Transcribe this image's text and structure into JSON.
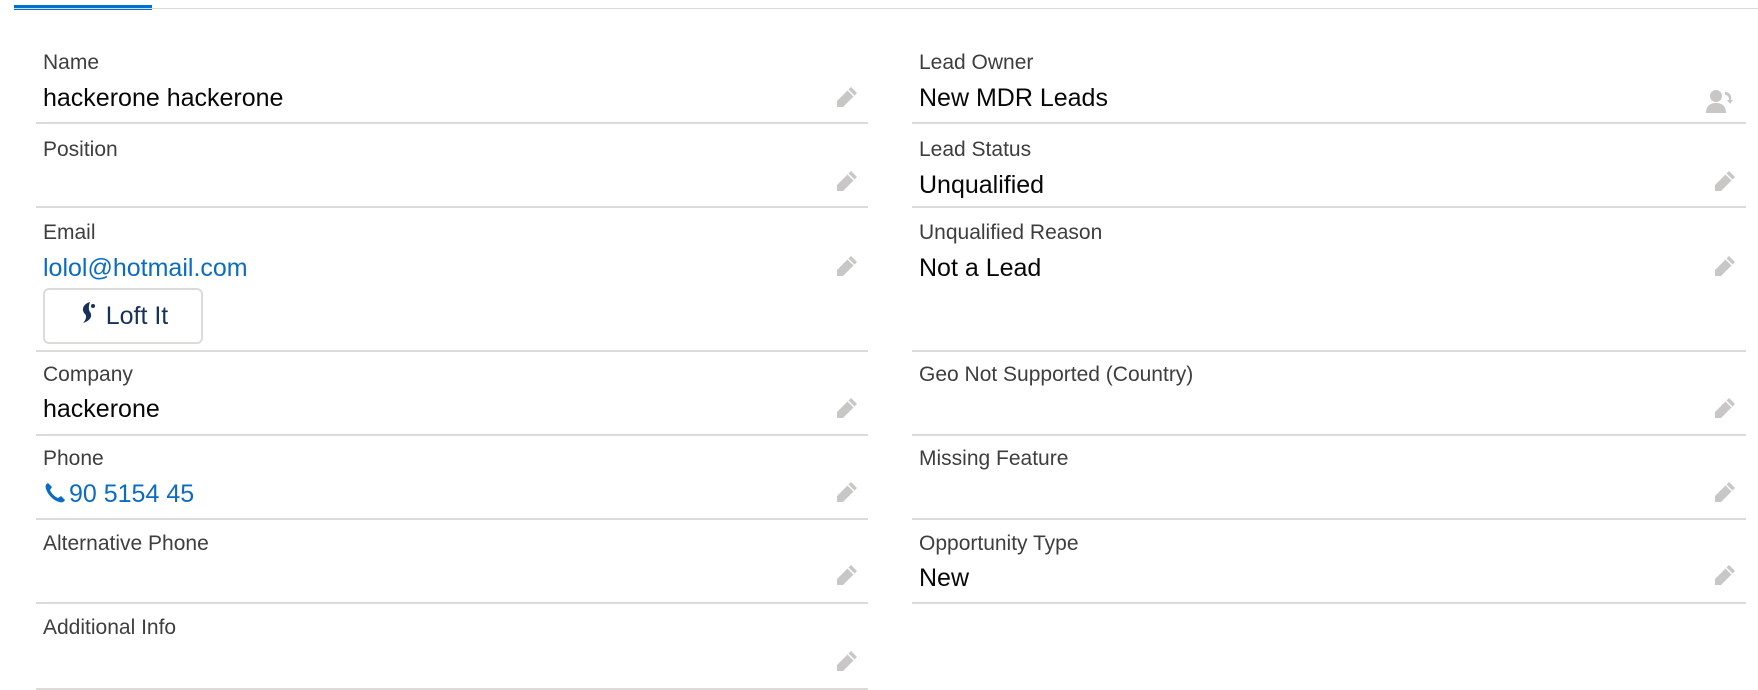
{
  "left_fields": [
    {
      "label": "Name",
      "value": "hackerone hackerone"
    },
    {
      "label": "Position",
      "value": ""
    },
    {
      "label": "Email",
      "value": "lolol@hotmail.com",
      "button_label": "Loft It"
    },
    {
      "label": "Company",
      "value": "hackerone"
    },
    {
      "label": "Phone",
      "value": "90 5154 45"
    },
    {
      "label": "Alternative Phone",
      "value": ""
    },
    {
      "label": "Additional Info",
      "value": ""
    }
  ],
  "right_fields": [
    {
      "label": "Lead Owner",
      "value": "New MDR Leads"
    },
    {
      "label": "Lead Status",
      "value": "Unqualified"
    },
    {
      "label": "Unqualified Reason",
      "value": "Not a Lead"
    },
    {
      "label": "Geo Not Supported (Country)",
      "value": ""
    },
    {
      "label": "Missing Feature",
      "value": ""
    },
    {
      "label": "Opportunity Type",
      "value": "New"
    }
  ],
  "colors": {
    "accent": "#0070d2",
    "link": "#0b6cc4",
    "divider": "#dddbda",
    "label": "#3e3e3c",
    "icon": "#c9c7c5"
  },
  "icons": {
    "edit": "pencil-icon",
    "owner": "change-owner-icon",
    "phone": "phone-icon",
    "loft": "loft-logo-icon"
  }
}
